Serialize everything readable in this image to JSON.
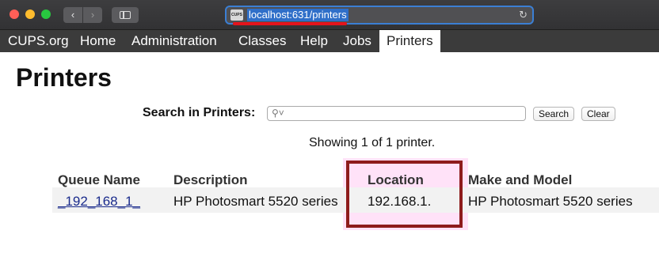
{
  "browser": {
    "favicon_text": "CUPS",
    "url": "localhost:631/printers",
    "back_icon": "chevron-left-icon",
    "forward_icon": "chevron-right-icon",
    "reload_icon": "reload-icon"
  },
  "nav": {
    "items": [
      "CUPS.org",
      "Home",
      "Administration",
      "Classes",
      "Help",
      "Jobs",
      "Printers"
    ],
    "active": "Printers"
  },
  "page": {
    "title": "Printers",
    "search_label": "Search in Printers:",
    "search_value": "",
    "search_button": "Search",
    "clear_button": "Clear",
    "showing": "Showing 1 of 1 printer."
  },
  "table": {
    "headers": [
      "Queue Name",
      "Description",
      "Location",
      "Make and Model"
    ],
    "rows": [
      [
        "_192_168_1_",
        "HP Photosmart 5520 series",
        "192.168.1.",
        "HP Photosmart 5520 series"
      ]
    ]
  },
  "colors": {
    "nav_bg": "#3b3b3b",
    "link": "#1a2b8c",
    "highlight_border": "#8e1c1c",
    "url_underline": "#e4141c"
  }
}
